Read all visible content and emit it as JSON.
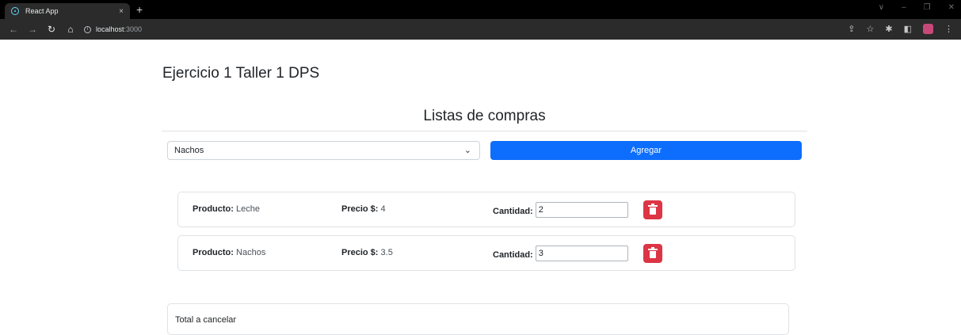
{
  "browser": {
    "tab_title": "React App",
    "tab_close": "×",
    "new_tab": "+",
    "window_controls": [
      "∨",
      "–",
      "❐",
      "✕"
    ],
    "url_host": "localhost",
    "url_port": ":3000",
    "icons": [
      "back-icon",
      "forward-icon",
      "reload-icon",
      "home-icon",
      "info-icon",
      "share-icon",
      "star-icon",
      "extensions-icon",
      "sidepanel-icon",
      "profile-icon",
      "menu-icon"
    ]
  },
  "page": {
    "title": "Ejercicio 1 Taller 1 DPS",
    "list_title": "Listas de compras",
    "select": {
      "value": "Nachos"
    },
    "add_button": "Agregar",
    "labels": {
      "product": "Producto:",
      "price": "Precio $:",
      "quantity": "Cantidad:"
    },
    "items": [
      {
        "product": "Leche",
        "price": "4",
        "quantity": "2"
      },
      {
        "product": "Nachos",
        "price": "3.5",
        "quantity": "3"
      }
    ],
    "total_label": "Total a cancelar"
  },
  "colors": {
    "primary": "#0d6efd",
    "danger": "#dc3545",
    "chrome_dark": "#2b2b2b"
  }
}
